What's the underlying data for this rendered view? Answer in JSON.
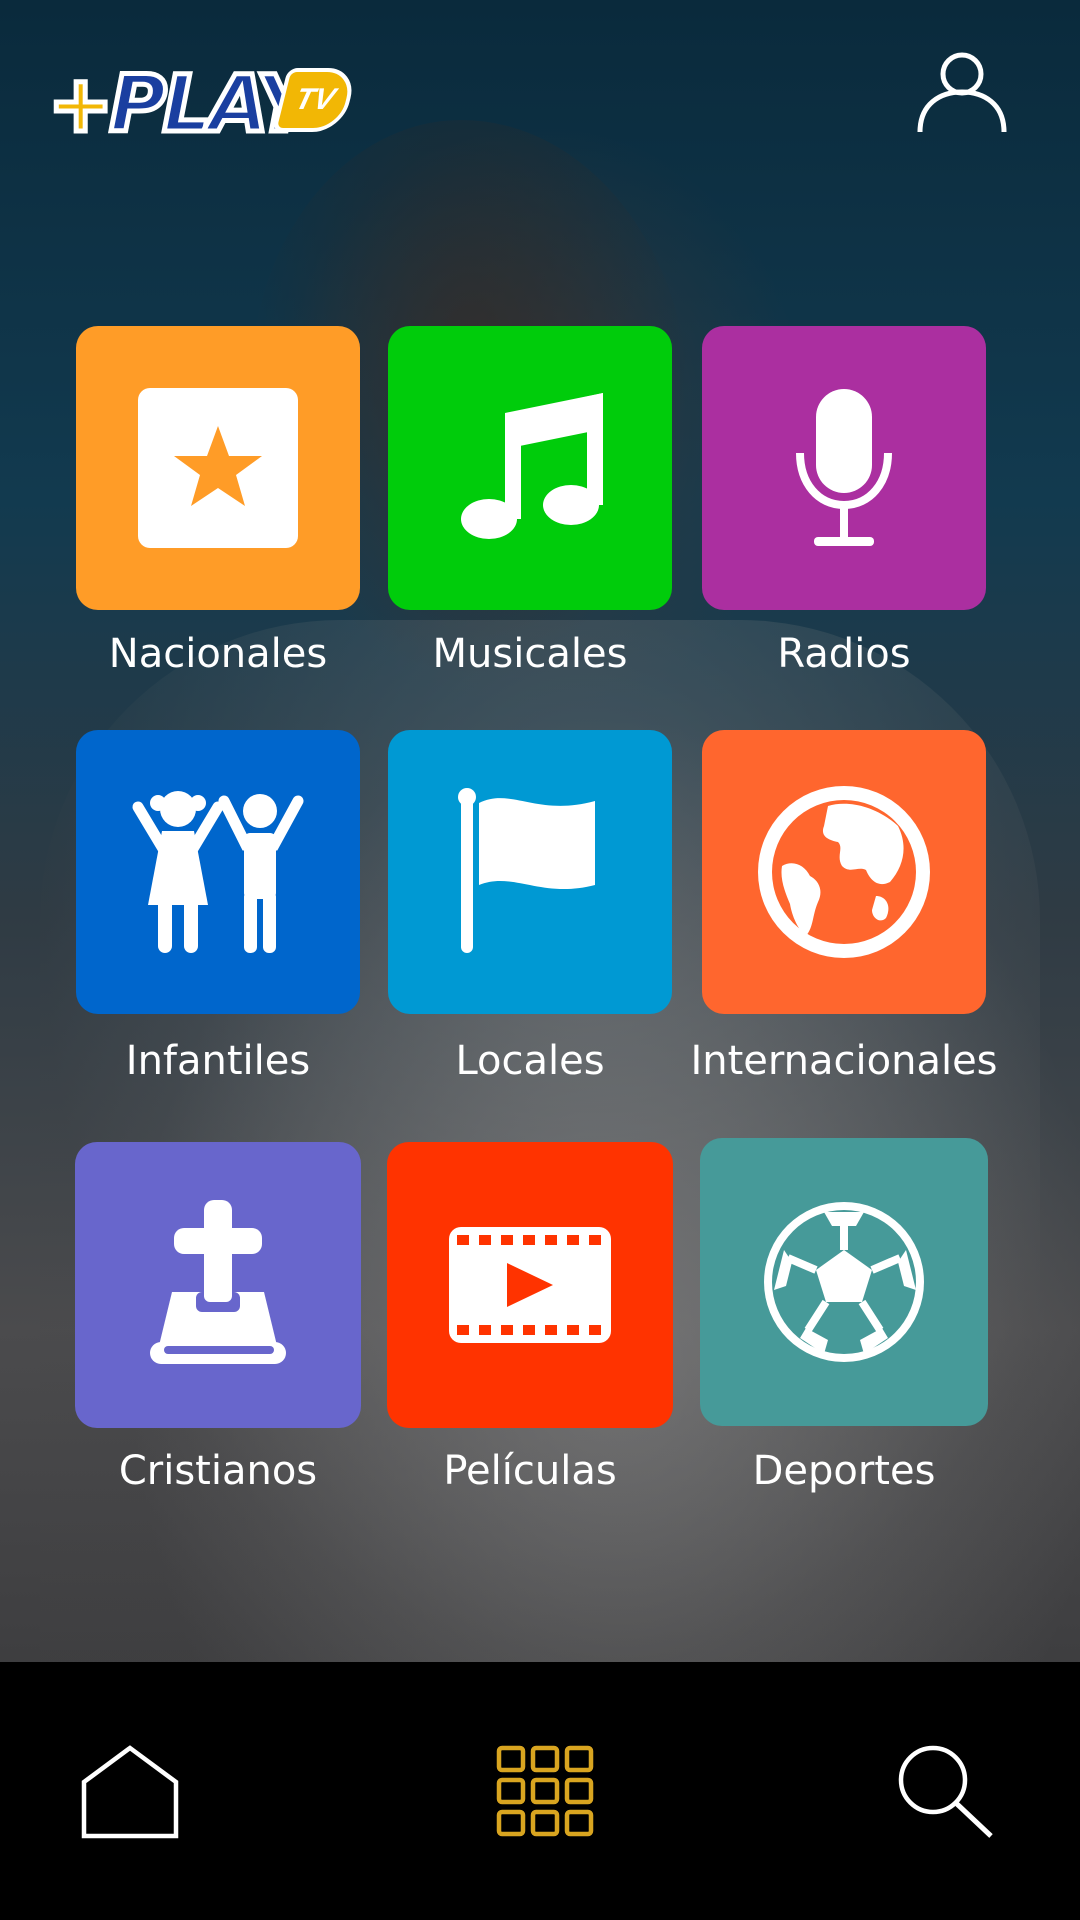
{
  "app": {
    "logo_text": "+PLAY",
    "logo_tv": "TV"
  },
  "header": {
    "profile_icon": "user-icon"
  },
  "categories": [
    {
      "label": "Nacionales",
      "color": "#FF9C27",
      "icon": "star-icon"
    },
    {
      "label": "Musicales",
      "color": "#00CC0B",
      "icon": "music-note-icon"
    },
    {
      "label": "Radios",
      "color": "#AB2FA0",
      "icon": "microphone-icon"
    },
    {
      "label": "Infantiles",
      "color": "#0066CC",
      "icon": "children-icon"
    },
    {
      "label": "Locales",
      "color": "#0099D3",
      "icon": "flag-icon"
    },
    {
      "label": "Internacionales",
      "color": "#FF662E",
      "icon": "globe-icon"
    },
    {
      "label": "Cristianos",
      "color": "#6866CC",
      "icon": "bible-cross-icon"
    },
    {
      "label": "Películas",
      "color": "#FF3300",
      "icon": "film-icon"
    },
    {
      "label": "Deportes",
      "color": "#469A99",
      "icon": "soccer-ball-icon"
    }
  ],
  "bottom_nav": {
    "items": [
      {
        "icon": "home-icon",
        "active": false
      },
      {
        "icon": "grid-icon",
        "active": true
      },
      {
        "icon": "search-icon",
        "active": false
      }
    ],
    "active_color": "#D9A520",
    "inactive_color": "#FFFFFF"
  }
}
